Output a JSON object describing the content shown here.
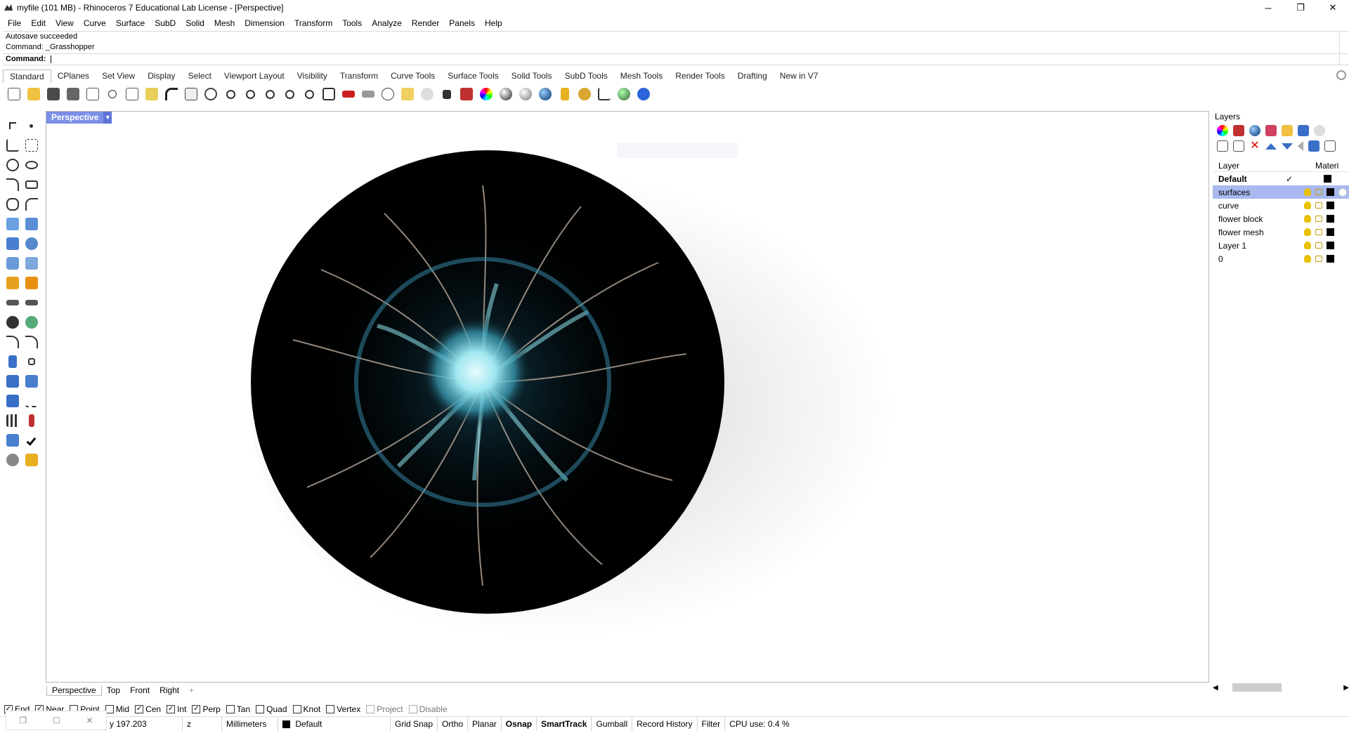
{
  "window": {
    "title": "myfile (101 MB) - Rhinoceros 7 Educational Lab License - [Perspective]",
    "controls": [
      "─",
      "❐",
      "✕"
    ]
  },
  "menu": [
    "File",
    "Edit",
    "View",
    "Curve",
    "Surface",
    "SubD",
    "Solid",
    "Mesh",
    "Dimension",
    "Transform",
    "Tools",
    "Analyze",
    "Render",
    "Panels",
    "Help"
  ],
  "command": {
    "history": [
      "Autosave succeeded",
      "Command: _Grasshopper"
    ],
    "prompt_label": "Command:"
  },
  "toolbar_tabs": [
    "Standard",
    "CPlanes",
    "Set View",
    "Display",
    "Select",
    "Viewport Layout",
    "Visibility",
    "Transform",
    "Curve Tools",
    "Surface Tools",
    "Solid Tools",
    "SubD Tools",
    "Mesh Tools",
    "Render Tools",
    "Drafting",
    "New in V7"
  ],
  "viewport": {
    "title": "Perspective",
    "tabs": [
      "Perspective",
      "Top",
      "Front",
      "Right"
    ],
    "add_tab_icon": "+"
  },
  "osnap": [
    {
      "label": "End",
      "checked": true
    },
    {
      "label": "Near",
      "checked": true
    },
    {
      "label": "Point",
      "checked": false
    },
    {
      "label": "Mid",
      "checked": false
    },
    {
      "label": "Cen",
      "checked": true
    },
    {
      "label": "Int",
      "checked": true
    },
    {
      "label": "Perp",
      "checked": true
    },
    {
      "label": "Tan",
      "checked": false
    },
    {
      "label": "Quad",
      "checked": false
    },
    {
      "label": "Knot",
      "checked": false
    },
    {
      "label": "Vertex",
      "checked": false
    },
    {
      "label": "Project",
      "checked": false,
      "disabled": true
    },
    {
      "label": "Disable",
      "checked": false,
      "disabled": true
    }
  ],
  "status": {
    "y": "y 197.203",
    "z": "z",
    "units": "Millimeters",
    "layer": "Default",
    "grid_snap": "Grid Snap",
    "ortho": "Ortho",
    "planar": "Planar",
    "osnap": "Osnap",
    "smarttrack": "SmartTrack",
    "gumball": "Gumball",
    "record_history": "Record History",
    "filter": "Filter",
    "cpu": "CPU use: 0.4 %"
  },
  "layers": {
    "title": "Layers",
    "col_layer": "Layer",
    "col_material": "Materi",
    "rows": [
      {
        "name": "Default",
        "current": true,
        "selected": false
      },
      {
        "name": "surfaces",
        "current": false,
        "selected": true
      },
      {
        "name": "curve",
        "current": false,
        "selected": false
      },
      {
        "name": "flower block",
        "current": false,
        "selected": false
      },
      {
        "name": "flower mesh",
        "current": false,
        "selected": false
      },
      {
        "name": "Layer 1",
        "current": false,
        "selected": false
      },
      {
        "name": "0",
        "current": false,
        "selected": false
      }
    ],
    "checkmark": "✓"
  },
  "colors": {
    "viewport_title_bg": "#7a8fe6",
    "selected_layer_bg": "#a9b8ef",
    "sphere": "#000000",
    "jelly_glow": "#8fe3ee"
  }
}
